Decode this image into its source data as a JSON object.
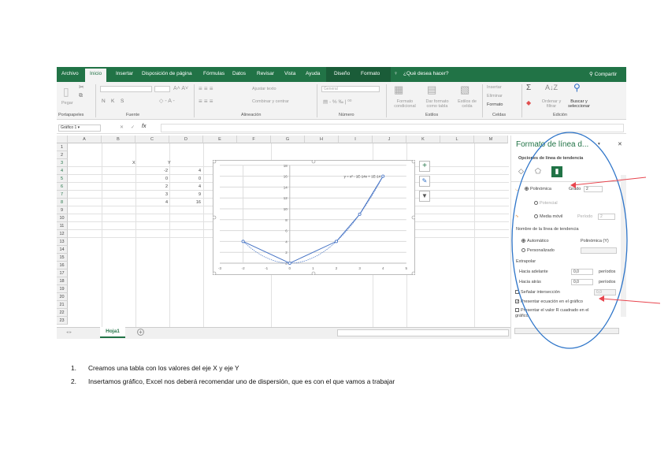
{
  "ribbon": {
    "tabs": [
      "Archivo",
      "Inicio",
      "Insertar",
      "Disposición de página",
      "Fórmulas",
      "Datos",
      "Revisar",
      "Vista",
      "Ayuda",
      "Diseño",
      "Formato"
    ],
    "active_tab": "Inicio",
    "tell_me": "¿Qué desea hacer?",
    "share": "Compartir",
    "groups": [
      "Portapapeles",
      "Fuente",
      "Alineación",
      "Número",
      "Estilos",
      "Celdas",
      "Edición"
    ],
    "paste": "Pegar",
    "bold": "N",
    "italic": "K",
    "underline": "S",
    "wrap_text": "Ajustar texto",
    "merge_center": "Combinar y centrar",
    "number_format": "General",
    "conditional_format": "Formato condicional",
    "format_table": "Dar formato como tabla",
    "cell_styles": "Estilos de celda",
    "insert": "Insertar",
    "delete": "Eliminar",
    "format": "Formato",
    "sort_filter": "Ordenar y filtrar",
    "find_select": "Buscar y seleccionar"
  },
  "formula_bar": {
    "name_box": "Gráfico 1",
    "fx": "fx",
    "cancel": "✕",
    "confirm": "✓",
    "value": ""
  },
  "grid": {
    "columns": [
      "A",
      "B",
      "C",
      "D",
      "E",
      "F",
      "G",
      "H",
      "I",
      "J",
      "K",
      "L",
      "M"
    ],
    "rows": [
      "1",
      "2",
      "3",
      "4",
      "5",
      "6",
      "7",
      "8",
      "9",
      "10",
      "11",
      "12",
      "13",
      "14",
      "15",
      "16",
      "17",
      "18",
      "19",
      "20",
      "21",
      "22",
      "23"
    ],
    "header_x": "X",
    "header_y": "Y",
    "x_values": [
      "-2",
      "0",
      "2",
      "3",
      "4"
    ],
    "y_values": [
      "4",
      "0",
      "4",
      "9",
      "16"
    ]
  },
  "sheet": {
    "tab": "Hoja1",
    "add": "+"
  },
  "chart_data": {
    "type": "scatter",
    "x": [
      -2,
      0,
      2,
      3,
      4
    ],
    "series": [
      {
        "name": "Y",
        "values": [
          4,
          0,
          4,
          9,
          16
        ]
      }
    ],
    "trendline": {
      "type": "polynomial",
      "order": 2,
      "equation": "y = x² - 1E-14x + 1E-14"
    },
    "xlim": [
      -3,
      5
    ],
    "ylim": [
      0,
      18
    ],
    "xticks": [
      "-3",
      "-2",
      "-1",
      "0",
      "1",
      "2",
      "3",
      "4",
      "5"
    ],
    "yticks": [
      "0",
      "2",
      "4",
      "6",
      "8",
      "10",
      "12",
      "14",
      "16",
      "18"
    ],
    "grid": true,
    "series_color": "#4472c4"
  },
  "pane": {
    "title": "Formato de línea d...",
    "subtitle": "Opciones de línea de tendencia",
    "polynomial": "Polinómica",
    "order_label": "Grado",
    "order_value": "2",
    "power": "Potencial",
    "moving_avg": "Media móvil",
    "period_label": "Período",
    "period_value": "2",
    "name_section": "Nombre de la línea de tendencia",
    "automatic": "Automático",
    "auto_name": "Polinómica (Y)",
    "custom": "Personalizado",
    "forecast": "Extrapolar",
    "forward": "Hacia adelante",
    "forward_value": "0,0",
    "backward": "Hacia atrás",
    "backward_value": "0,0",
    "periods": "períodos",
    "intercept": "Señalar intersección",
    "intercept_value": "0,0",
    "show_equation": "Presentar ecuación en el gráfico",
    "show_r2": "Presentar el valor R cuadrado en el gráfico"
  },
  "annotations": {
    "ellipse_color": "#2e75c9",
    "arrow_color": "#e8454e"
  },
  "document": {
    "steps": [
      {
        "num": "1.",
        "text": "Creamos una tabla con los valores del eje X y eje Y"
      },
      {
        "num": "2.",
        "text": "Insertamos gráfico, Excel nos deberá recomendar uno de dispersión, que es con el que vamos a trabajar"
      }
    ]
  }
}
